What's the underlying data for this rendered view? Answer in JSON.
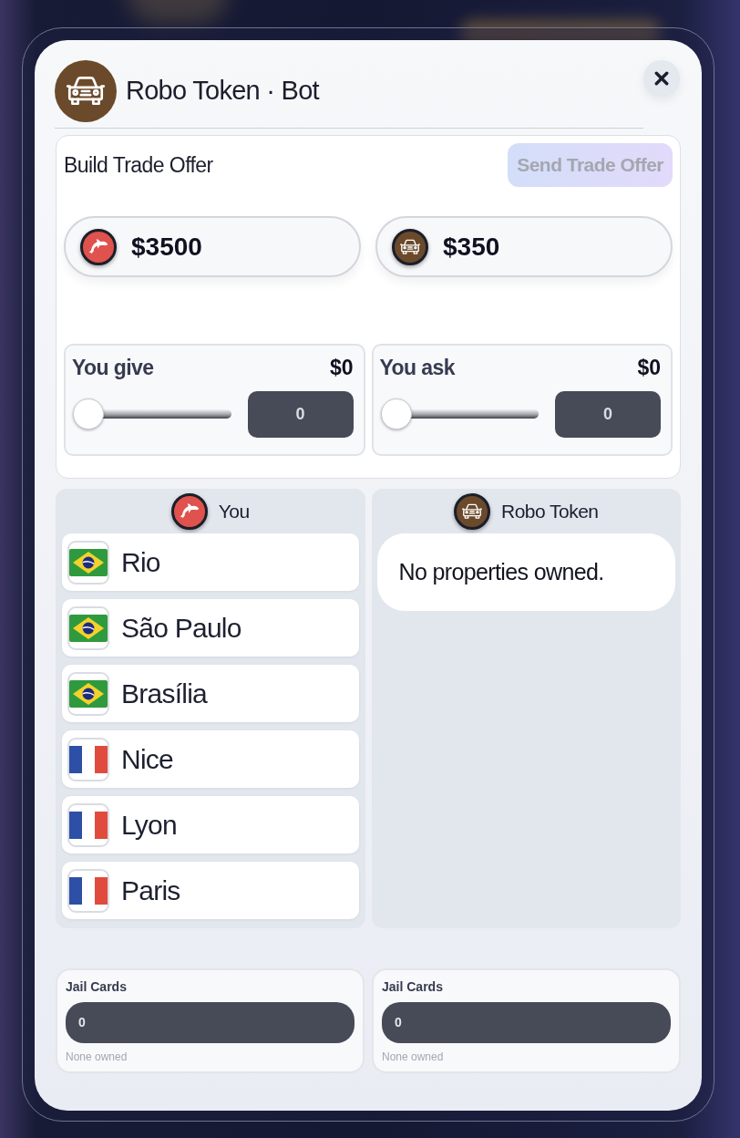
{
  "dialog": {
    "title": "Robo Token · Bot"
  },
  "offer": {
    "title": "Build Trade Offer",
    "send_button": {
      "label": "Send Trade Offer",
      "disabled": true
    },
    "balances": [
      {
        "kind": "dolphin",
        "color": "#e0524d",
        "amount": "$3500"
      },
      {
        "kind": "car",
        "color": "#6b4a2b",
        "amount": "$350"
      }
    ],
    "cash": [
      {
        "label": "You give",
        "amount": "$0",
        "level": 0,
        "value": "0"
      },
      {
        "label": "You ask",
        "amount": "$0",
        "level": 0,
        "value": "0"
      }
    ]
  },
  "holdings": [
    {
      "player": "You",
      "kind": "dolphin",
      "color": "#e0524d",
      "properties": [
        {
          "name": "Rio",
          "kind": "brazil"
        },
        {
          "name": "São Paulo",
          "kind": "brazil"
        },
        {
          "name": "Brasília",
          "kind": "brazil"
        },
        {
          "name": "Nice",
          "kind": "france"
        },
        {
          "name": "Lyon",
          "kind": "france"
        },
        {
          "name": "Paris",
          "kind": "france"
        }
      ]
    },
    {
      "player": "Robo Token",
      "kind": "car",
      "color": "#6b4a2b",
      "empty_note": "No properties owned."
    }
  ],
  "jail_cards": [
    {
      "label": "Jail Cards",
      "value": "0",
      "note": "None owned"
    },
    {
      "label": "Jail Cards",
      "value": "0",
      "note": "None owned"
    }
  ]
}
